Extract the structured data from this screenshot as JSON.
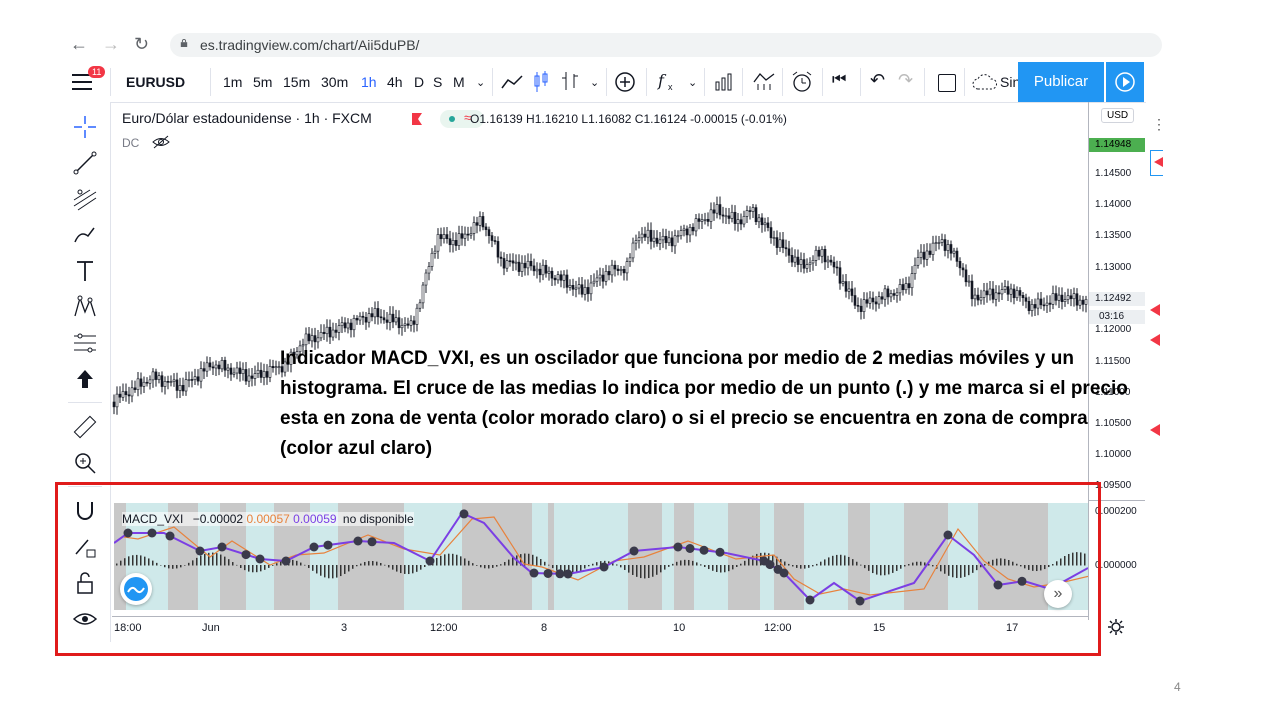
{
  "browser": {
    "url": "es.tradingview.com/chart/Aii5duPB/"
  },
  "toolbar": {
    "symbol": "EURUSD",
    "notification_count": "11",
    "intervals": [
      "1m",
      "5m",
      "15m",
      "30m",
      "1h",
      "4h",
      "D",
      "S",
      "M"
    ],
    "active_interval": "1h",
    "snapshot_label": "Sin",
    "publish_label": "Publicar"
  },
  "legend": {
    "title": "Euro/Dólar estadounidense · 1h · FXCM",
    "ohlc": "O1.16139 H1.16210 L1.16082 C1.16124 -0.00015 (-0.01%)",
    "dc": "DC"
  },
  "price_axis": {
    "currency": "USD",
    "current_price": "1.14948",
    "last_price": "1.12492",
    "countdown": "03:16",
    "labels": [
      "1.14500",
      "1.14000",
      "1.13500",
      "1.13000",
      "1.12000",
      "1.11500",
      "1.11000",
      "1.10500",
      "1.10000",
      "1.09500",
      "0.000200",
      "0.000000"
    ]
  },
  "overlay": {
    "text": "Indicador MACD_VXI, es un oscilador que funciona por medio de 2 medias móviles y un histograma. El cruce de las medias lo indica por medio de un punto (.) y me marca si el precio esta en zona de venta (color morado claro) o si el precio se encuentra en zona de compra (color azul claro)"
  },
  "indicator": {
    "name": "MACD_VXI",
    "v1": "−0.00002",
    "v2": "0.00057",
    "v3": "0.00059",
    "status": "no disponible",
    "colors": {
      "line_fast": "#7b3fe4",
      "line_slow": "#e8823c",
      "sell_zone": "#c8c8c8",
      "buy_zone": "#cfe9ea",
      "dots": "#3a3a4a"
    }
  },
  "time_axis": {
    "labels": [
      "18:00",
      "Jun",
      "3",
      "12:00",
      "8",
      "10",
      "12:00",
      "15",
      "17"
    ]
  },
  "page_number": "4"
}
